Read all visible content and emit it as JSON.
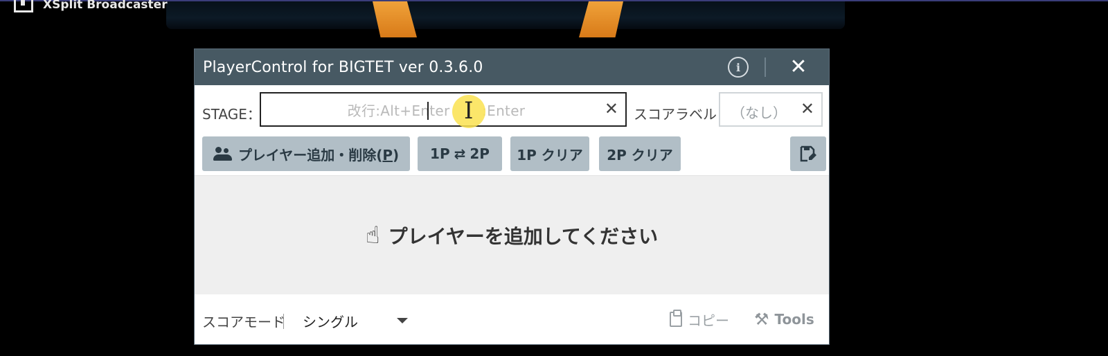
{
  "desktop": {
    "app_name": "XSplit Broadcaster"
  },
  "window": {
    "title": "PlayerControl for BIGTET ver 0.3.6.0",
    "info_icon": "info-icon",
    "close_icon": "close-icon"
  },
  "stage": {
    "label": "STAGE：",
    "placeholder_left": "改行:Alt+Enter",
    "placeholder_right": ":Enter",
    "value": "",
    "clear_icon": "close-icon"
  },
  "score_label": {
    "label": "スコアラベル：",
    "placeholder": "（なし）",
    "clear_icon": "close-icon"
  },
  "toolbar": {
    "add_remove_players_prefix": "プレイヤー追加・削除(",
    "add_remove_players_key": "P",
    "add_remove_players_suffix": ")",
    "swap_left": "1P",
    "swap_right": "2P",
    "clear_1p": "1P クリア",
    "clear_2p": "2P クリア",
    "add_icon": "people-icon",
    "swap_icon": "swap-icon",
    "save_icon": "save-edit-icon"
  },
  "main": {
    "message": "プレイヤーを追加してください",
    "icon": "hand-pointer-icon"
  },
  "footer": {
    "score_mode_label": "スコアモード",
    "score_mode_value": "シングル",
    "copy_label": "コピー",
    "tools_label": "Tools",
    "copy_icon": "clipboard-icon",
    "tools_icon": "tools-icon"
  },
  "colors": {
    "titlebar": "#475963",
    "button": "#b1bec6",
    "main_bg": "#efefef",
    "cursor_highlight": "#fae250"
  }
}
